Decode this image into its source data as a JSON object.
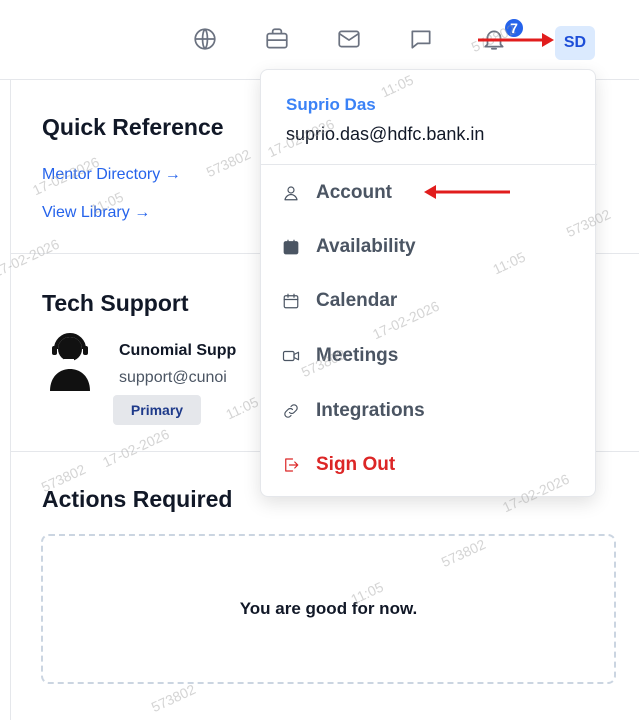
{
  "header": {
    "notification_count": "7",
    "avatar_initials": "SD",
    "icons": [
      "globe-icon",
      "briefcase-icon",
      "mail-icon",
      "chat-icon",
      "bell-icon"
    ]
  },
  "quick_reference": {
    "title": "Quick Reference",
    "links": [
      "Mentor Directory →",
      "View Library →"
    ]
  },
  "tech_support": {
    "title": "Tech Support",
    "name": "Cunomial Supp",
    "email": "support@cunoi",
    "badge": "Primary"
  },
  "actions_required": {
    "title": "Actions Required",
    "empty_message": "You are good for now."
  },
  "profile_menu": {
    "name": "Suprio Das",
    "email": "suprio.das@hdfc.bank.in",
    "items": [
      {
        "label": "Account",
        "icon": "user-icon"
      },
      {
        "label": "Availability",
        "icon": "calendar-check-icon"
      },
      {
        "label": "Calendar",
        "icon": "calendar-icon"
      },
      {
        "label": "Meetings",
        "icon": "video-icon"
      },
      {
        "label": "Integrations",
        "icon": "link-icon"
      },
      {
        "label": "Sign Out",
        "icon": "sign-out-icon"
      }
    ]
  },
  "watermark": {
    "id": "573802",
    "date": "17-02-2026",
    "time": "11:05"
  },
  "colors": {
    "accent_blue": "#2563eb",
    "danger_red": "#dc2626",
    "annotation_red": "#e11d1d"
  }
}
